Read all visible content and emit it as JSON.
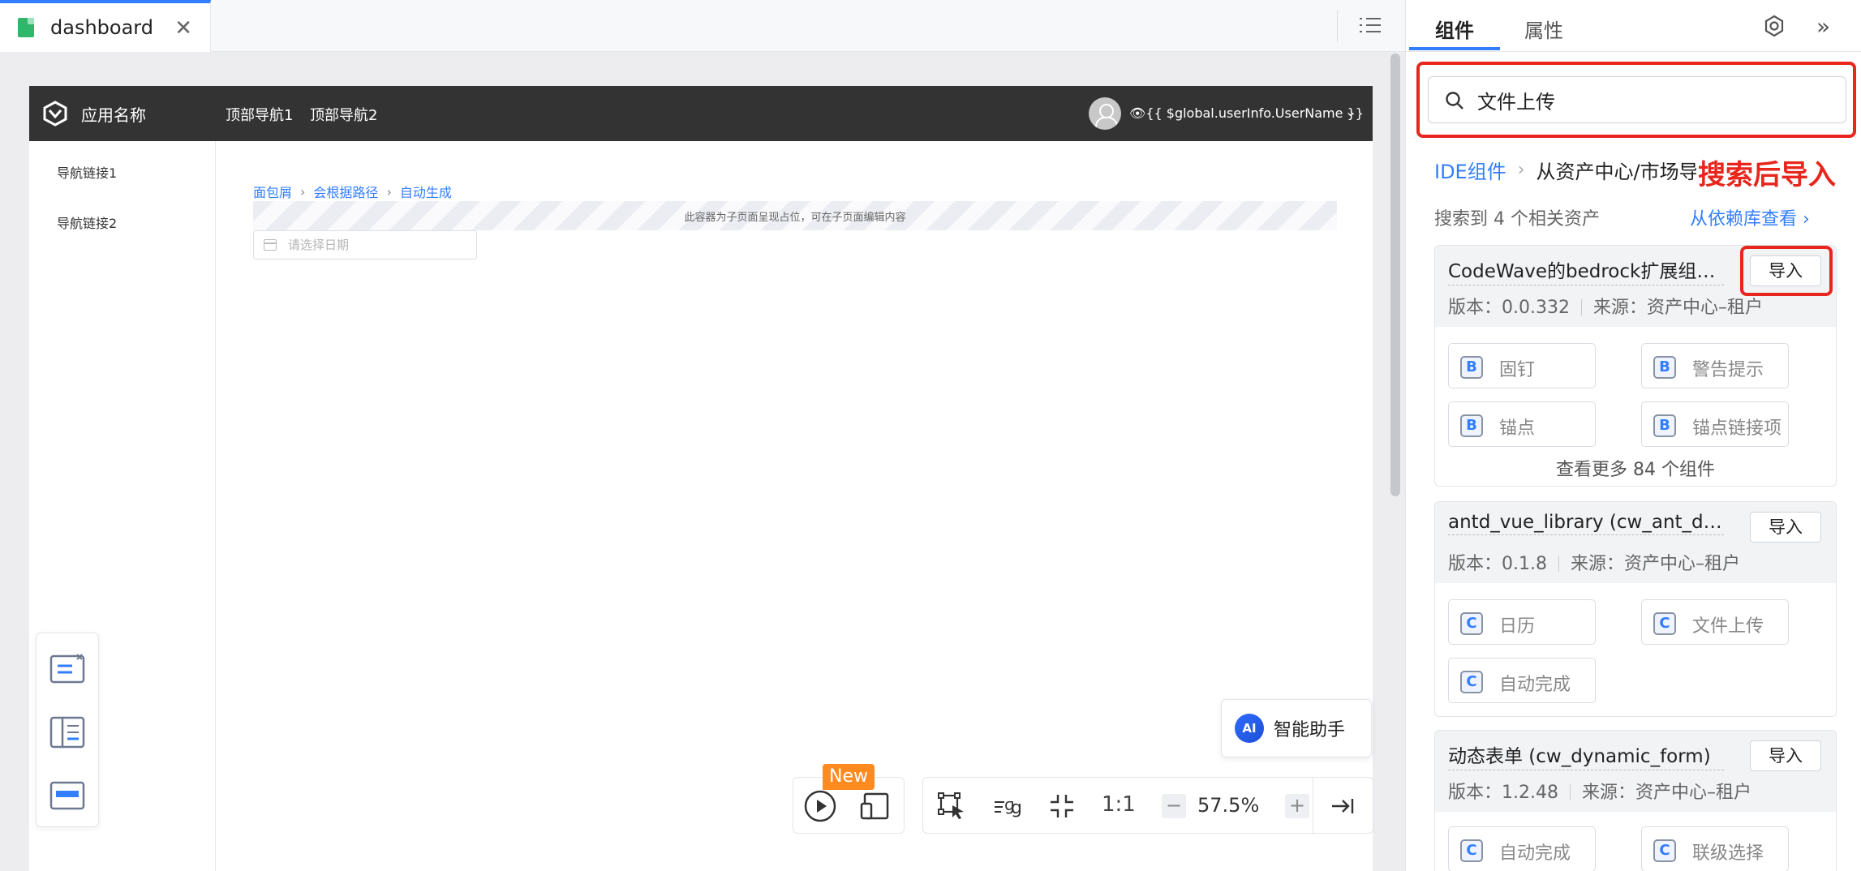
{
  "editor": {
    "file_tab": {
      "name": "dashboard",
      "close": "✕"
    }
  },
  "preview": {
    "app_name": "应用名称",
    "top_nav": [
      "顶部导航1",
      "顶部导航2"
    ],
    "user_name": "👁{{ $global.userInfo.UserName }}",
    "caret": "⌄",
    "side_nav": [
      "导航链接1",
      "导航链接2"
    ],
    "breadcrumb": [
      "面包屑",
      "会根据路径",
      "自动生成"
    ],
    "breadcrumb_sep": "›",
    "placeholder_text": "此容器为子页面呈现占位，可在子页面编辑内容",
    "date_placeholder": "请选择日期"
  },
  "ai_helper": {
    "badge": "AI",
    "label": "智能助手"
  },
  "toolbar": {
    "new_badge": "New",
    "ratio": "1:1",
    "zoom": "57.5%",
    "minus": "−",
    "plus": "+"
  },
  "panel": {
    "tabs": [
      "组件",
      "属性"
    ],
    "collapse": "»",
    "search_value": "文件上传",
    "crumb": [
      "IDE组件",
      "从资产中心/市场导入"
    ],
    "crumb_sep": "›",
    "annotation": "搜索后导入",
    "result_count": "搜索到 4 个相关资产",
    "repo_link": "从依赖库查看 ›",
    "import_label": "导入",
    "cards": [
      {
        "title": "CodeWave的bedrock扩展组件库",
        "version": "版本：0.0.332",
        "source": "来源：资产中心–租户",
        "components": [
          {
            "badge": "B",
            "label": "固钉"
          },
          {
            "badge": "B",
            "label": "警告提示"
          },
          {
            "badge": "B",
            "label": "锚点"
          },
          {
            "badge": "B",
            "label": "锚点链接项"
          }
        ],
        "more": "查看更多 84 个组件"
      },
      {
        "title": "antd_vue_library (cw_ant_design_vue)",
        "version": "版本：0.1.8",
        "source": "来源：资产中心–租户",
        "components": [
          {
            "badge": "C",
            "label": "日历"
          },
          {
            "badge": "C",
            "label": "文件上传"
          },
          {
            "badge": "C",
            "label": "自动完成"
          }
        ]
      },
      {
        "title": "动态表单 (cw_dynamic_form)",
        "version": "版本：1.2.48",
        "source": "来源：资产中心–租户",
        "components": [
          {
            "badge": "C",
            "label": "自动完成"
          },
          {
            "badge": "C",
            "label": "联级选择"
          }
        ]
      }
    ]
  },
  "colors": {
    "accent": "#337eff",
    "highlight": "#e8261d",
    "header_bg": "#333333",
    "new_badge": "#ff8a1f"
  }
}
